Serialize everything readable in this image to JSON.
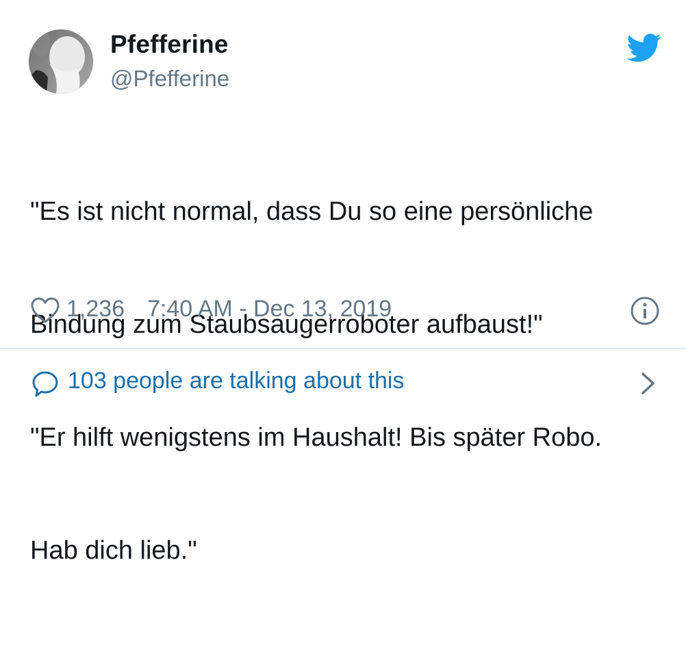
{
  "user": {
    "display_name": "Pfefferine",
    "handle": "@Pfefferine"
  },
  "tweet": {
    "text_lines": [
      "\"Es ist nicht normal, dass Du so eine persönliche",
      "Bindung zum Staubsaugerroboter aufbaust!\"",
      "\"Er hilft wenigstens im Haushalt! Bis später Robo.",
      "Hab dich lieb.\""
    ],
    "like_count": "1,236",
    "timestamp": "7:40 AM - Dec 13, 2019"
  },
  "conversation": {
    "label": "103 people are talking about this"
  },
  "icons": {
    "brand": "twitter-bird-icon",
    "like": "heart-icon",
    "info": "info-icon",
    "reply": "speech-bubble-icon",
    "more": "chevron-right-icon"
  },
  "colors": {
    "twitter_blue": "#1da1f2",
    "muted_text": "#657786",
    "link_text": "#1b6ea8",
    "divider": "#e1e8ed"
  }
}
